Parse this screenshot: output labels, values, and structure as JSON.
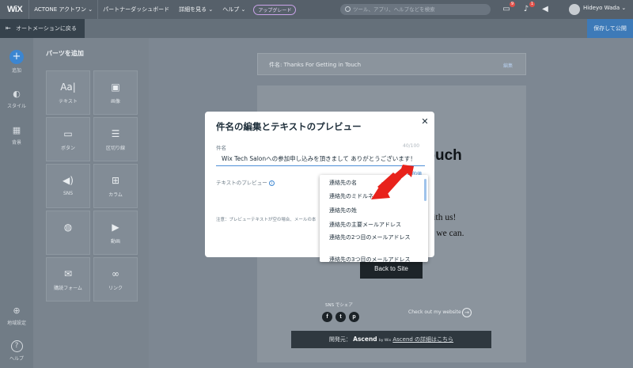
{
  "topbar": {
    "logo": "WiX",
    "site_name": "ACTONE アクトワン",
    "partner_dashboard": "パートナーダッシュボード",
    "learn_more": "詳細を見る",
    "help": "ヘルプ",
    "upgrade": "アップグレード",
    "search_placeholder": "ツール、アプリ、ヘルプなどを検索",
    "notifications_count": "9",
    "alerts_count": "1",
    "user_name": "Hideyo Wada"
  },
  "subbar": {
    "back_label": "オートメーションに戻る",
    "save_label": "保存して公開"
  },
  "leftrail": {
    "add": "追加",
    "style": "スタイル",
    "background": "背景",
    "region": "地域設定",
    "help": "ヘルプ"
  },
  "parts": {
    "title": "パーツを追加",
    "tiles": [
      {
        "label": "テキスト",
        "icon": "text-icon"
      },
      {
        "label": "画像",
        "icon": "image-icon"
      },
      {
        "label": "ボタン",
        "icon": "button-icon"
      },
      {
        "label": "区切り線",
        "icon": "divider-icon"
      },
      {
        "label": "SNS",
        "icon": "megaphone-icon"
      },
      {
        "label": "カラム",
        "icon": "columns-icon"
      },
      {
        "label": "",
        "icon": "coupon-icon"
      },
      {
        "label": "動画",
        "icon": "video-icon"
      },
      {
        "label": "購読フォーム",
        "icon": "mail-icon"
      },
      {
        "label": "リンク",
        "icon": "link-icon"
      }
    ]
  },
  "email": {
    "subject_prefix": "件名:",
    "subject": "Thanks For Getting in Touch",
    "edit": "編集",
    "heading": "in Touch",
    "line1": "with us!",
    "line2": "s we can.",
    "back_to_site": "Back to Site",
    "share_label": "SNS でシェア",
    "checkout": "Check out my website",
    "footer_prefix": "開発元：",
    "footer_brand": "Ascend",
    "footer_by": "by Wix",
    "footer_link": "Ascend の詳細はこちら"
  },
  "modal": {
    "title": "件名の編集とテキストのプレビュー",
    "subject_label": "件名",
    "char_count": "40/100",
    "subject_value": "Wix Tech Salonへの参加申し込みを頂きまして ありがとうございます！",
    "dynamic_text": "動的値",
    "preview_label": "テキストのプレビュー",
    "note": "注意：プレビューテキストが空の場合、メールの本",
    "dropdown_options": [
      "連絡先の名",
      "連絡先のミドルネーム",
      "連絡先の姓",
      "連絡先の主要メールアドレス",
      "連絡先の2つ目のメールアドレス",
      "連絡先の3つ目のメールアドレス"
    ]
  },
  "colors": {
    "accent": "#3c86d1",
    "annotation_arrow": "#e8221b"
  }
}
